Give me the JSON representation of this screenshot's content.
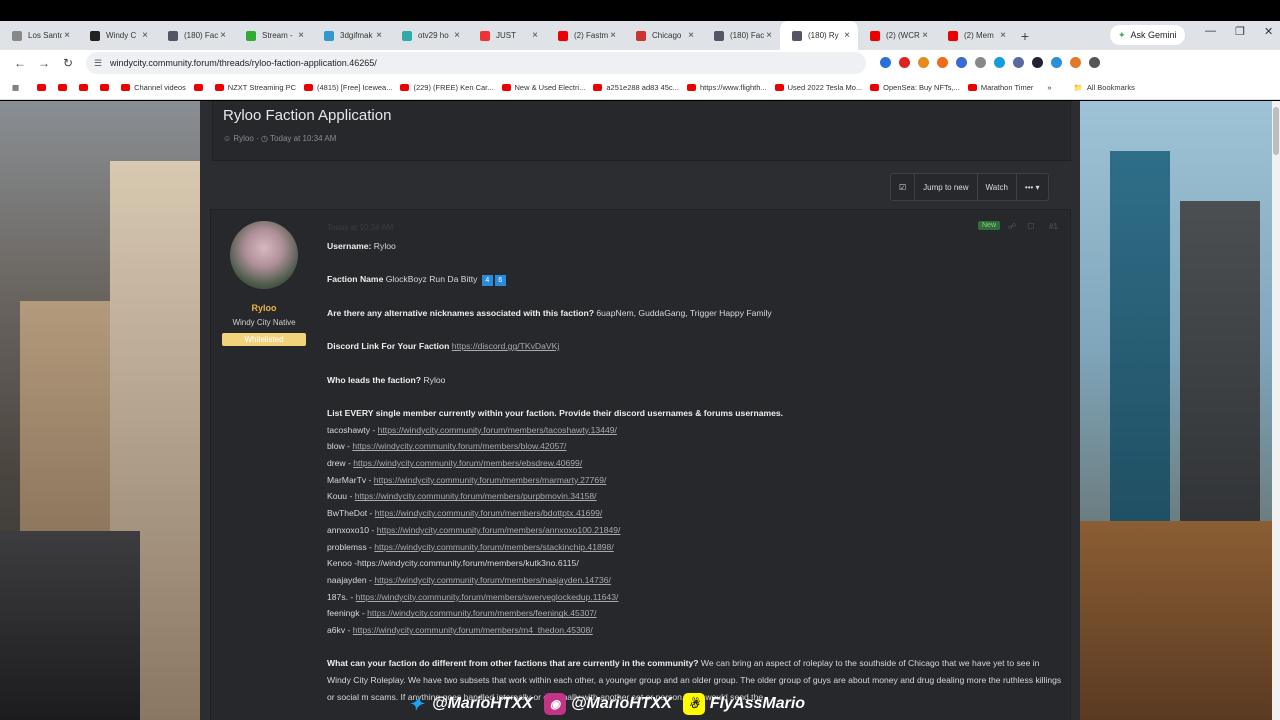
{
  "browser": {
    "tabs": [
      {
        "label": "Los Santo",
        "color": "#888"
      },
      {
        "label": "Windy C",
        "color": "#222"
      },
      {
        "label": "(180) Fac",
        "color": "#556"
      },
      {
        "label": "Stream -",
        "color": "#3a3"
      },
      {
        "label": "3dgifmak",
        "color": "#39c"
      },
      {
        "label": "otv29 ho",
        "color": "#3aa"
      },
      {
        "label": "JUST",
        "color": "#e33"
      },
      {
        "label": "(2) Fastm",
        "color": "#e00"
      },
      {
        "label": "Chicago",
        "color": "#c33"
      },
      {
        "label": "(180) Fac",
        "color": "#556"
      },
      {
        "label": "(180) Ry",
        "color": "#556"
      },
      {
        "label": "(2) (WCR",
        "color": "#e00"
      },
      {
        "label": "(2) Mem",
        "color": "#e00"
      }
    ],
    "new_tab": "+",
    "ask_gemini": "Ask Gemini",
    "url": "windycity.community.forum/threads/ryloo-faction-application.46265/",
    "bookmarks": [
      "",
      "",
      "",
      "",
      "Channel videos",
      "",
      "NZXT Streaming PC",
      "(4815) [Free] Icewea...",
      "(229) (FREE) Ken Car...",
      "New & Used Electri...",
      "a251e288 ad83 45c...",
      "https://www.flighth...",
      "Used 2022 Tesla Mo...",
      "OpenSea: Buy NFTs,...",
      "Marathon Timer"
    ],
    "all_bookmarks": "All Bookmarks"
  },
  "thread": {
    "title": "Ryloo Faction Application",
    "author": "Ryloo",
    "date": "Today at 10:34 AM",
    "jump_to_new": "Jump to new",
    "watch": "Watch",
    "more": "••• ▾"
  },
  "post": {
    "username": "Ryloo",
    "user_title": "Windy City Native",
    "badge": "Whitelisted",
    "date": "Today at 10:34 AM",
    "new_label": "New",
    "number": "#1",
    "fields": {
      "username_label": "Username:",
      "username_value": " Ryloo",
      "faction_label": "Faction Name",
      "faction_value": " GlockBoyz Run Da Bitty",
      "faction_e1": "4",
      "faction_e2": "6",
      "nick_label": "Are there any alternative nicknames associated with this faction?",
      "nick_value": " 6uapNem, GuddaGang, Trigger Happy Family",
      "discord_label": "Discord Link For Your Faction",
      "discord_value": "https://discord.gg/TKvDaVKj",
      "leads_label": "Who leads the faction?",
      "leads_value": " Ryloo",
      "members_label": "List EVERY single member currently within your faction. Provide their discord usernames & forums usernames.",
      "members": [
        {
          "name": "tacoshawty - ",
          "link": "https://windycity.community.forum/members/tacoshawty.13449/"
        },
        {
          "name": "blow - ",
          "link": "https://windycity.community.forum/members/blow.42057/"
        },
        {
          "name": "drew - ",
          "link": "https://windycity.community.forum/members/ebsdrew.40699/"
        },
        {
          "name": "MarMarTv - ",
          "link": "https://windycity.community.forum/members/marmarty.27769/"
        },
        {
          "name": "Kouu - ",
          "link": "https://windycity.community.forum/members/purpbmovin.34158/"
        },
        {
          "name": "BwTheDot - ",
          "link": "https://windycity.community.forum/members/bdottptx.41699/"
        },
        {
          "name": "annxoxo10 - ",
          "link": "https://windycity.community.forum/members/annxoxo100.21849/"
        },
        {
          "name": "problemss - ",
          "link": "https://windycity.community.forum/members/stackinchip.41898/"
        },
        {
          "name": "Kenoo -https://windycity.community.forum/members/kutk3no.6115/",
          "link": ""
        },
        {
          "name": "naajayden - ",
          "link": "https://windycity.community.forum/members/naajayden.14736/"
        },
        {
          "name": "187s. - ",
          "link": "https://windycity.community.forum/members/swerveglockedup.11643/"
        },
        {
          "name": "feeningk - ",
          "link": "https://windycity.community.forum/members/feeningk.45307/"
        },
        {
          "name": "a6kv - ",
          "link": "https://windycity.community.forum/members/m4_thedon.45308/"
        }
      ],
      "diff_label": "What can your faction do different from other factions that are currently in the community?",
      "diff_value": " We can bring an aspect of roleplay to the southside of Chicago that we have yet to see in Windy City Roleplay. We have two subsets that work within each other, a younger group and an older group. The older group of guys are about money and drug dealing more the ruthless killings or social m scams. If anything goes handled internally or externally with another set or person, they would send the"
    }
  },
  "overlay": {
    "twitter": "@MarioHTXX",
    "instagram": "@MarioHTXX",
    "snapchat": "FlyAssMario"
  }
}
